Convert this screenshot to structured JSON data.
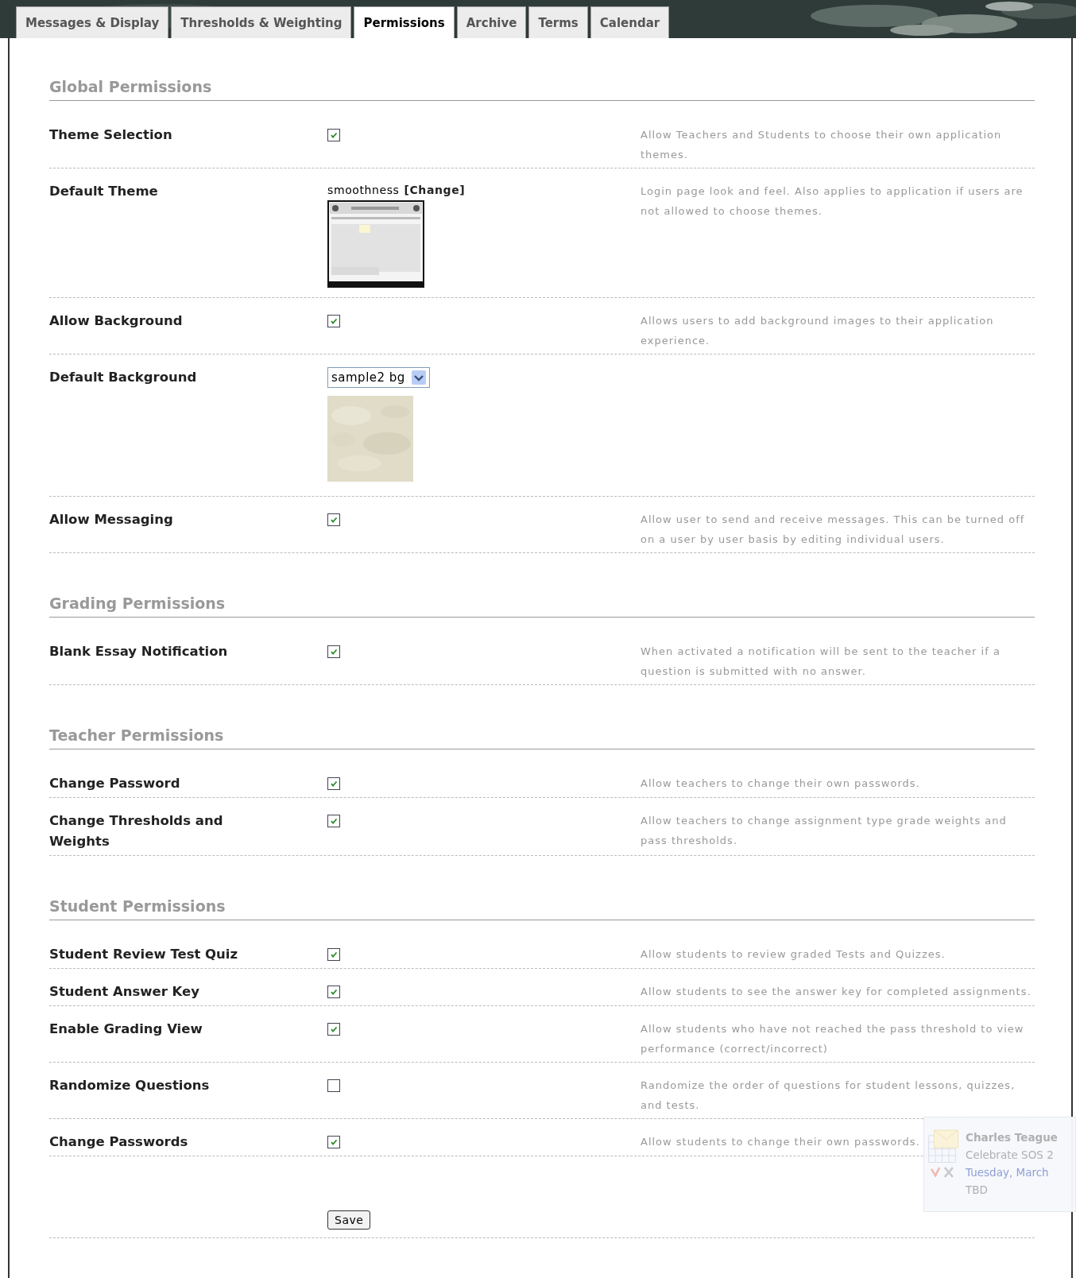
{
  "tabs": [
    {
      "label": "Messages & Display",
      "selected": false
    },
    {
      "label": "Thresholds & Weighting",
      "selected": false
    },
    {
      "label": "Permissions",
      "selected": true
    },
    {
      "label": "Archive",
      "selected": false
    },
    {
      "label": "Terms",
      "selected": false
    },
    {
      "label": "Calendar",
      "selected": false
    }
  ],
  "sections": [
    {
      "title": "Global Permissions",
      "rows": [
        {
          "kind": "checkbox",
          "label": "Theme Selection",
          "checked": true,
          "description": "Allow Teachers and Students to choose their own application themes."
        },
        {
          "kind": "theme",
          "label": "Default Theme",
          "value": "smoothness",
          "link": "[Change]",
          "description": "Login page look and feel. Also applies to application if users are not allowed to choose themes."
        },
        {
          "kind": "checkbox",
          "label": "Allow Background",
          "checked": true,
          "description": "Allows users to add background images to their application experience."
        },
        {
          "kind": "select",
          "label": "Default Background",
          "value": "sample2 bg"
        },
        {
          "kind": "checkbox",
          "label": "Allow Messaging",
          "checked": true,
          "description": "Allow user to send and receive messages. This can be turned off on a user by user basis by editing individual users."
        }
      ]
    },
    {
      "title": "Grading Permissions",
      "rows": [
        {
          "kind": "checkbox",
          "label": "Blank Essay Notification",
          "checked": true,
          "description": "When activated a notification will be sent to the teacher if a question is submitted with no answer."
        }
      ]
    },
    {
      "title": "Teacher Permissions",
      "rows": [
        {
          "kind": "checkbox",
          "label": "Change Password",
          "checked": true,
          "description": "Allow teachers to change their own passwords."
        },
        {
          "kind": "checkbox",
          "label": "Change Thresholds and Weights",
          "checked": true,
          "description": "Allow teachers to change assignment type grade weights and pass thresholds."
        }
      ]
    },
    {
      "title": "Student Permissions",
      "rows": [
        {
          "kind": "checkbox",
          "label": "Student Review Test Quiz",
          "checked": true,
          "description": "Allow students to review graded Tests and Quizzes."
        },
        {
          "kind": "checkbox",
          "label": "Student Answer Key",
          "checked": true,
          "description": "Allow students to see the answer key for completed assignments."
        },
        {
          "kind": "checkbox",
          "label": "Enable Grading View",
          "checked": true,
          "description": "Allow students who have not reached the pass threshold to view performance (correct/incorrect)"
        },
        {
          "kind": "checkbox",
          "label": "Randomize Questions",
          "checked": false,
          "description": "Randomize the order of questions for student lessons, quizzes, and tests."
        },
        {
          "kind": "checkbox",
          "label": "Change Passwords",
          "checked": true,
          "description": "Allow students to change their own passwords."
        }
      ]
    }
  ],
  "save_button": "Save",
  "reminder": {
    "sender": "Charles Teague",
    "subject": "Celebrate SOS 2",
    "date": "Tuesday, March",
    "location": "TBD"
  }
}
